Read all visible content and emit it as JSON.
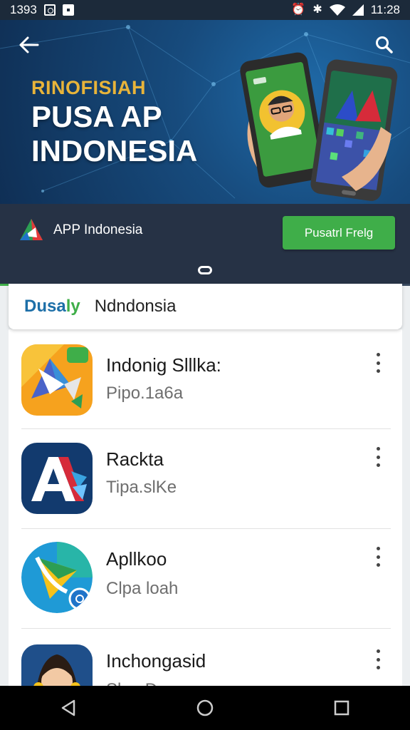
{
  "status_bar": {
    "left_time": "1393",
    "right_time": "11:28",
    "icons": [
      "camera-icon",
      "notification-icon",
      "alarm-icon",
      "bluetooth-icon",
      "wifi-icon",
      "signal-icon"
    ]
  },
  "hero": {
    "kicker": "RINOFISIAH",
    "title_line1": "PUSA AP",
    "title_line2": "INDONESIA",
    "back_icon": "back-arrow-icon",
    "search_icon": "search-icon"
  },
  "app_header": {
    "name": "APP Indonesia",
    "install_label": "Pusatrl Frelg",
    "progress_percent": 59,
    "colors": {
      "strip": "#263245",
      "button": "#3fae49"
    }
  },
  "search": {
    "brand_part1": "Dusa",
    "brand_part2": "ly",
    "query": "Ndndonsia"
  },
  "apps": [
    {
      "title": "Indonig Slllka:",
      "subtitle": "Pipo.1a6a",
      "icon": "origami-arrow-app-icon"
    },
    {
      "title": "Rackta",
      "subtitle": "Tipa.slKe",
      "icon": "letter-a-app-icon"
    },
    {
      "title": "Apllkoo",
      "subtitle": "Clpa loah",
      "icon": "play-triangle-app-icon"
    },
    {
      "title": "Inchongasid",
      "subtitle": "Slan Deure",
      "icon": "woman-avatar-app-icon"
    }
  ],
  "nav": {
    "back_icon": "nav-back-icon",
    "home_icon": "nav-home-icon",
    "recents_icon": "nav-recents-icon"
  }
}
